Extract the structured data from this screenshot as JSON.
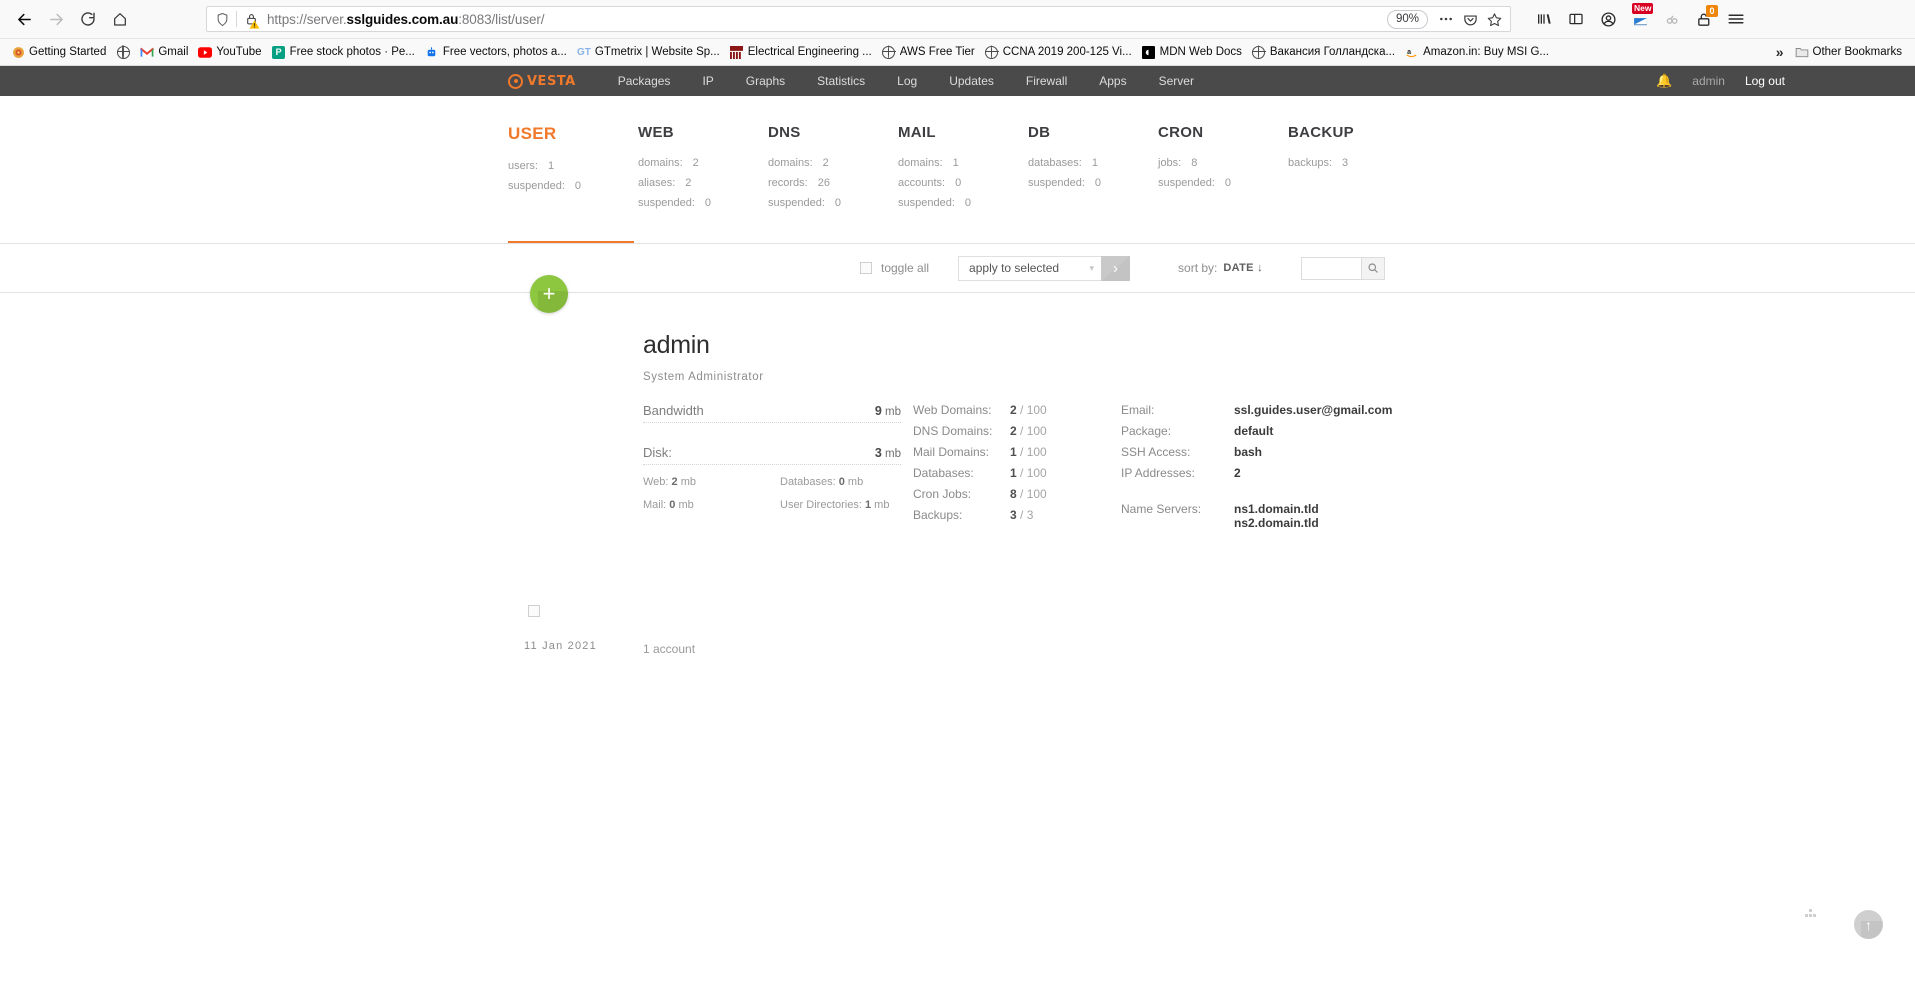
{
  "browser": {
    "url_prefix": "https://server.",
    "url_host": "sslguides.com.au",
    "url_suffix": ":8083/list/user/",
    "zoom_level": "90%",
    "nav": {
      "back": "back-button",
      "forward": "forward-button",
      "reload": "reload-button",
      "home": "home-button"
    },
    "toolbar_right_badges": {
      "new_label": "New",
      "count": "0"
    },
    "bookmarks": [
      {
        "label": "Getting Started",
        "icon": "firefox-icon",
        "color": "#e8a33d"
      },
      {
        "label": "Gmail",
        "icon": "gmail-icon",
        "color": "#ea4335"
      },
      {
        "label": "YouTube",
        "icon": "youtube-icon",
        "color": "#ff0000"
      },
      {
        "label": "Free stock photos · Pe...",
        "icon": "pexels-icon",
        "color": "#05a081"
      },
      {
        "label": "Free vectors, photos a...",
        "icon": "freepik-icon",
        "color": "#1273eb"
      },
      {
        "label": "GTmetrix | Website Sp...",
        "icon": "gtmetrix-icon",
        "color": "#8ab4e8"
      },
      {
        "label": "Electrical Engineering ...",
        "icon": "mit-icon",
        "color": "#8c1515"
      },
      {
        "label": "AWS Free Tier",
        "icon": "globe-icon",
        "color": ""
      },
      {
        "label": "CCNA 2019 200-125 Vi...",
        "icon": "globe-icon",
        "color": ""
      },
      {
        "label": "MDN Web Docs",
        "icon": "mdn-icon",
        "color": "#000000"
      },
      {
        "label": "Вакансия Голландска...",
        "icon": "globe-icon",
        "color": ""
      },
      {
        "label": "Amazon.in: Buy MSI G...",
        "icon": "amazon-icon",
        "color": "#ff9900"
      }
    ],
    "other_bookmarks": "Other Bookmarks"
  },
  "vesta": {
    "brand": "VESTA",
    "nav_items": [
      "Packages",
      "IP",
      "Graphs",
      "Statistics",
      "Log",
      "Updates",
      "Firewall",
      "Apps",
      "Server"
    ],
    "user": "admin",
    "logout": "Log out",
    "accent_color": "#f0792b",
    "stats": [
      {
        "title": "USER",
        "active": true,
        "lines": [
          {
            "k": "users:",
            "v": "1"
          },
          {
            "k": "suspended:",
            "v": "0"
          }
        ]
      },
      {
        "title": "WEB",
        "active": false,
        "lines": [
          {
            "k": "domains:",
            "v": "2"
          },
          {
            "k": "aliases:",
            "v": "2"
          },
          {
            "k": "suspended:",
            "v": "0"
          }
        ]
      },
      {
        "title": "DNS",
        "active": false,
        "lines": [
          {
            "k": "domains:",
            "v": "2"
          },
          {
            "k": "records:",
            "v": "26"
          },
          {
            "k": "suspended:",
            "v": "0"
          }
        ]
      },
      {
        "title": "MAIL",
        "active": false,
        "lines": [
          {
            "k": "domains:",
            "v": "1"
          },
          {
            "k": "accounts:",
            "v": "0"
          },
          {
            "k": "suspended:",
            "v": "0"
          }
        ]
      },
      {
        "title": "DB",
        "active": false,
        "lines": [
          {
            "k": "databases:",
            "v": "1"
          },
          {
            "k": "suspended:",
            "v": "0"
          }
        ]
      },
      {
        "title": "CRON",
        "active": false,
        "lines": [
          {
            "k": "jobs:",
            "v": "8"
          },
          {
            "k": "suspended:",
            "v": "0"
          }
        ]
      },
      {
        "title": "BACKUP",
        "active": false,
        "lines": [
          {
            "k": "backups:",
            "v": "3"
          }
        ]
      }
    ],
    "toolbar": {
      "toggle_all": "toggle all",
      "apply_selected": "apply to selected",
      "go_label": "›",
      "sort_by_label": "sort by:",
      "sort_by_value": "DATE ↓",
      "search_value": "",
      "search_placeholder": ""
    },
    "add_button": "+",
    "record": {
      "date": "11 Jan 2021",
      "name": "admin",
      "role": "System Administrator",
      "usage": {
        "bandwidth_label": "Bandwidth",
        "bandwidth_value": "9",
        "bandwidth_unit": "mb",
        "disk_label": "Disk:",
        "disk_value": "3",
        "disk_unit": "mb",
        "breakdown": [
          {
            "k": "Web:",
            "v": "2",
            "u": "mb"
          },
          {
            "k": "Databases:",
            "v": "0",
            "u": "mb"
          },
          {
            "k": "Mail:",
            "v": "0",
            "u": "mb"
          },
          {
            "k": "User Directories:",
            "v": "1",
            "u": "mb"
          }
        ]
      },
      "quotas": [
        {
          "k": "Web Domains:",
          "used": "2",
          "limit": "/ 100"
        },
        {
          "k": "DNS Domains:",
          "used": "2",
          "limit": "/ 100"
        },
        {
          "k": "Mail Domains:",
          "used": "1",
          "limit": "/ 100"
        },
        {
          "k": "Databases:",
          "used": "1",
          "limit": "/ 100"
        },
        {
          "k": "Cron Jobs:",
          "used": "8",
          "limit": "/ 100"
        },
        {
          "k": "Backups:",
          "used": "3",
          "limit": "/ 3"
        }
      ],
      "info": [
        {
          "k": "Email:",
          "v": "ssl.guides.user@gmail.com"
        },
        {
          "k": "Package:",
          "v": "default"
        },
        {
          "k": "SSH Access:",
          "v": "bash"
        },
        {
          "k": "IP Addresses:",
          "v": "2"
        }
      ],
      "name_servers_label": "Name Servers:",
      "name_servers": [
        "ns1.domain.tld",
        "ns2.domain.tld"
      ]
    },
    "account_count": "1 account"
  }
}
